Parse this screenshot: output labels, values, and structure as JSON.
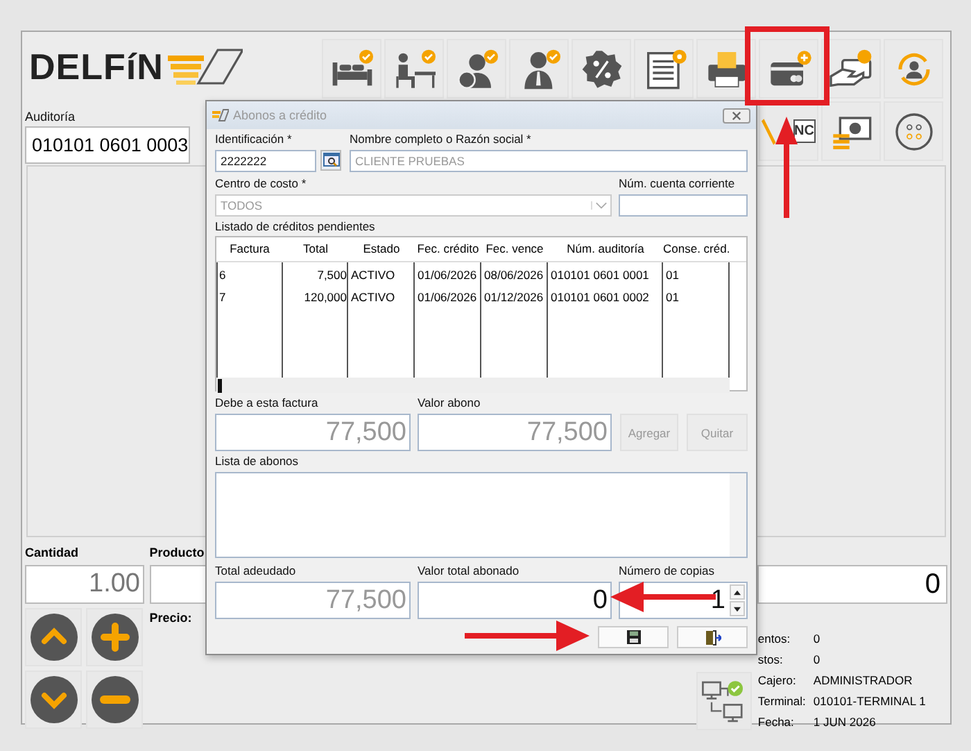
{
  "app": {
    "logo": "DELFíN",
    "nc_label": "NC"
  },
  "audit": {
    "label": "Auditoría",
    "value": "010101 0601 0003"
  },
  "quantity": {
    "label": "Cantidad",
    "value": "1.00"
  },
  "product": {
    "label": "Producto"
  },
  "price_label": "Precio:",
  "total_display": "0",
  "info": [
    {
      "label": "entos:",
      "value": "0"
    },
    {
      "label": "stos:",
      "value": "0"
    },
    {
      "label": "Cajero:",
      "value": "ADMINISTRADOR"
    },
    {
      "label": "Terminal:",
      "value": "010101-TERMINAL 1"
    },
    {
      "label": "Fecha:",
      "value": "1 JUN 2026"
    }
  ],
  "dialog": {
    "title": "Abonos a crédito",
    "identification": {
      "label": "Identificación *",
      "value": "2222222"
    },
    "name": {
      "label": "Nombre completo o Razón social *",
      "value": "CLIENTE PRUEBAS",
      "disabled": true
    },
    "cost_center": {
      "label": "Centro de costo *",
      "value": "TODOS",
      "disabled": true
    },
    "account": {
      "label": "Núm. cuenta corriente"
    },
    "credits": {
      "label": "Listado de créditos pendientes",
      "columns": [
        "Factura",
        "Total",
        "Estado",
        "Fec. crédito",
        "Fec. vence",
        "Núm. auditoría",
        "Conse. créd."
      ],
      "rows": [
        [
          "6",
          "7,500",
          "ACTIVO",
          "01/06/2026",
          "08/06/2026",
          "010101 0601 0001",
          "01"
        ],
        [
          "7",
          "120,000",
          "ACTIVO",
          "01/06/2026",
          "01/12/2026",
          "010101 0601 0002",
          "01"
        ]
      ]
    },
    "debt": {
      "label": "Debe a esta factura",
      "value": "77,500",
      "disabled": true
    },
    "payment": {
      "label": "Valor abono",
      "value": "77,500",
      "disabled": true
    },
    "buttons": [
      {
        "label": "Agregar",
        "disabled": true
      },
      {
        "label": "Quitar",
        "disabled": true
      }
    ],
    "payments_list": {
      "label": "Lista de abonos"
    },
    "total_due": {
      "label": "Total adeudado",
      "value": "77,500",
      "disabled": true
    },
    "total_paid": {
      "label": "Valor total abonado",
      "value": "0",
      "disabled": false
    },
    "copies": {
      "label": "Número de copias",
      "value": "1"
    }
  }
}
